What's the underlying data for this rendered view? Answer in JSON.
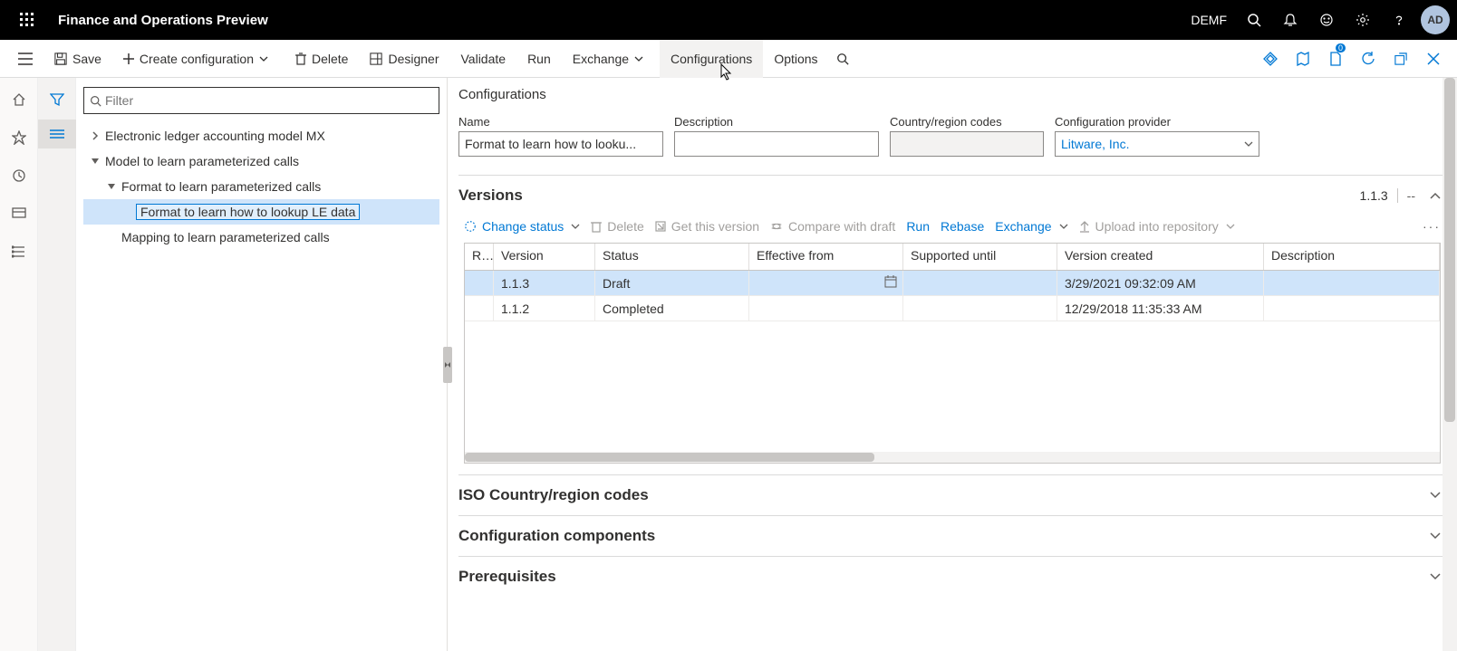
{
  "topbar": {
    "title": "Finance and Operations Preview",
    "company": "DEMF",
    "avatar": "AD"
  },
  "cmdbar": {
    "save": "Save",
    "create": "Create configuration",
    "delete": "Delete",
    "designer": "Designer",
    "validate": "Validate",
    "run": "Run",
    "exchange": "Exchange",
    "configurations": "Configurations",
    "options": "Options",
    "doc_badge": "0"
  },
  "tree": {
    "filter_placeholder": "Filter",
    "items": [
      {
        "label": "Electronic ledger accounting model MX",
        "indent": 1,
        "expander": "right",
        "selected": false
      },
      {
        "label": "Model to learn parameterized calls",
        "indent": 1,
        "expander": "down",
        "selected": false
      },
      {
        "label": "Format to learn parameterized calls",
        "indent": 2,
        "expander": "down",
        "selected": false
      },
      {
        "label": "Format to learn how to lookup LE data",
        "indent": 3,
        "expander": "none",
        "selected": true
      },
      {
        "label": "Mapping to learn parameterized calls",
        "indent": 2,
        "expander": "none",
        "selected": false
      }
    ]
  },
  "main": {
    "page_title": "Configurations",
    "fields": {
      "name_label": "Name",
      "name_value": "Format to learn how to looku...",
      "desc_label": "Description",
      "desc_value": "",
      "crc_label": "Country/region codes",
      "crc_value": "",
      "provider_label": "Configuration provider",
      "provider_value": "Litware, Inc."
    },
    "versions": {
      "title": "Versions",
      "summary": "1.1.3",
      "summary2": "--",
      "toolbar": {
        "change_status": "Change status",
        "delete": "Delete",
        "get_version": "Get this version",
        "compare": "Compare with draft",
        "run": "Run",
        "rebase": "Rebase",
        "exchange": "Exchange",
        "upload": "Upload into repository",
        "more": "···"
      },
      "columns": {
        "r": "R...",
        "version": "Version",
        "status": "Status",
        "eff": "Effective from",
        "sup": "Supported until",
        "vc": "Version created",
        "desc": "Description"
      },
      "rows": [
        {
          "version": "1.1.3",
          "status": "Draft",
          "eff": "",
          "sup": "",
          "vc": "3/29/2021 09:32:09 AM",
          "desc": "",
          "selected": true
        },
        {
          "version": "1.1.2",
          "status": "Completed",
          "eff": "",
          "sup": "",
          "vc": "12/29/2018 11:35:33 AM",
          "desc": "",
          "selected": false
        }
      ]
    },
    "sections": {
      "iso": "ISO Country/region codes",
      "comp": "Configuration components",
      "prereq": "Prerequisites"
    }
  }
}
